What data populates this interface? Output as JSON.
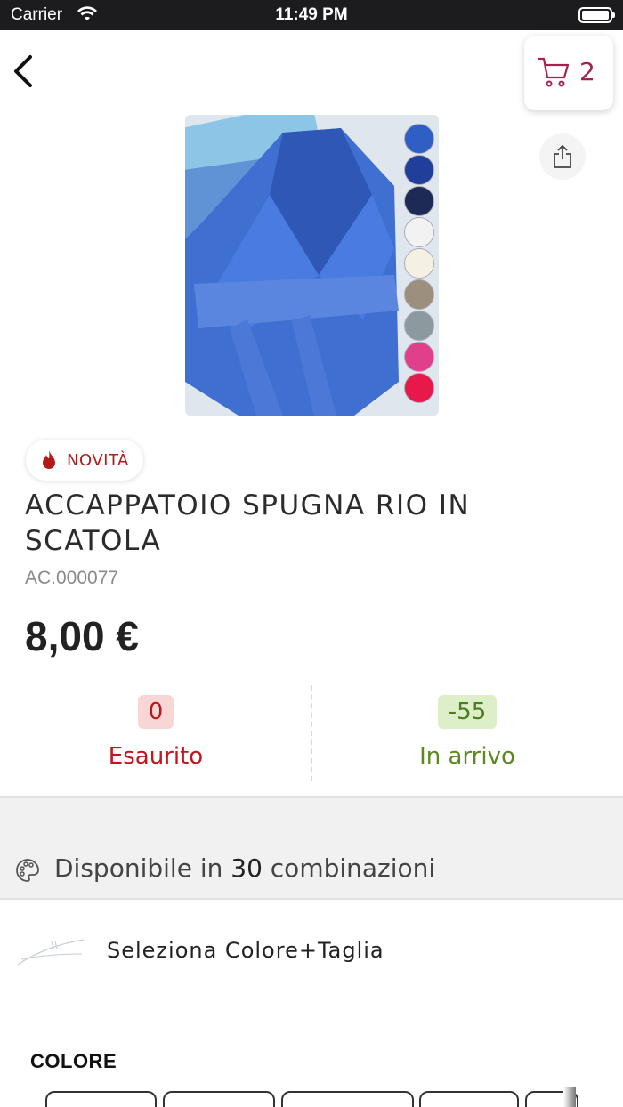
{
  "status_bar": {
    "carrier": "Carrier",
    "time": "11:49 PM"
  },
  "header": {
    "cart_count": "2"
  },
  "badge": {
    "label": "NOVITÀ"
  },
  "product": {
    "title": "ACCAPPATOIO SPUGNA RIO IN SCATOLA",
    "sku": "AC.000077",
    "price": "8,00 €",
    "swatch_colors": [
      "#2f5fc4",
      "#1f3f9a",
      "#1c2a55",
      "#f2f2f2",
      "#f4f1e4",
      "#9c8f7d",
      "#8c9aa0",
      "#e0408a",
      "#e6194a"
    ]
  },
  "stock": {
    "available_qty": "0",
    "available_label": "Esaurito",
    "incoming_qty": "-55",
    "incoming_label": "In arrivo"
  },
  "combinations": {
    "prefix": "Disponibile in ",
    "count": "30",
    "suffix": " combinazioni"
  },
  "selector": {
    "label": "Seleziona Colore+Taglia"
  },
  "color_section": {
    "heading": "COLORE"
  },
  "colors": {
    "accent": "#a3224f",
    "error": "#c0161c",
    "success": "#5a8a1f"
  }
}
